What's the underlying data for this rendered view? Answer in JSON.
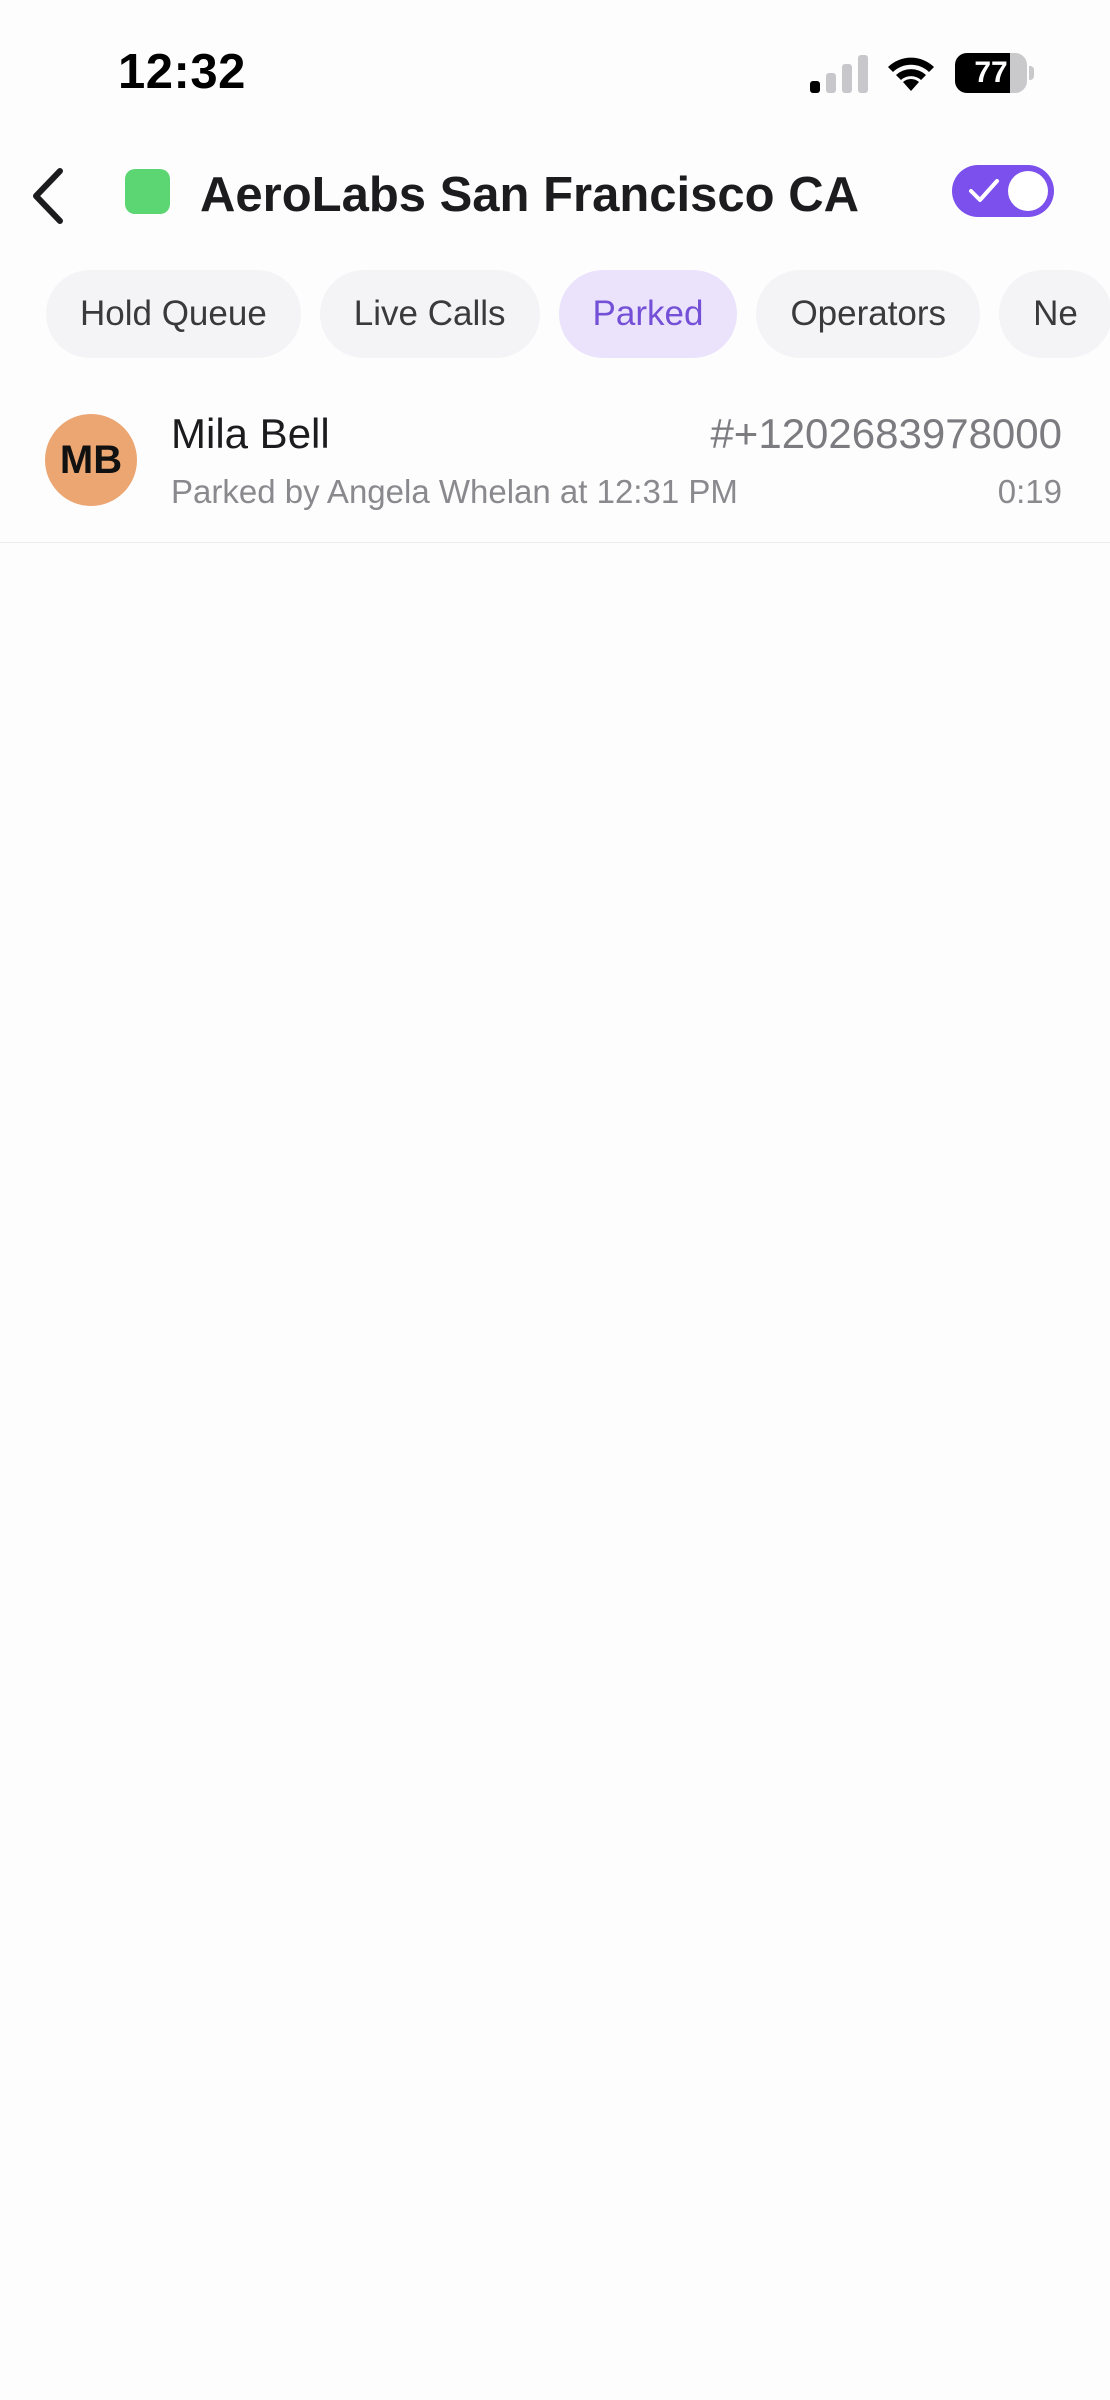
{
  "status_bar": {
    "time": "12:32",
    "battery_level": "77",
    "battery_fraction": 0.77,
    "signal_bars_active": 1,
    "signal_bars_total": 4
  },
  "header": {
    "back_icon": "chevron-left-icon",
    "title": "AeroLabs San Francisco CA",
    "status_color": "#5cd672",
    "toggle_on": true,
    "toggle_color": "#7b50ec"
  },
  "tabs": [
    {
      "label": "Hold Queue",
      "active": false
    },
    {
      "label": "Live Calls",
      "active": false
    },
    {
      "label": "Parked",
      "active": true
    },
    {
      "label": "Operators",
      "active": false
    },
    {
      "label": "Ne",
      "active": false
    }
  ],
  "parked_calls": [
    {
      "initials": "MB",
      "avatar_color": "#eba672",
      "name": "Mila Bell",
      "number": "#+1202683978000",
      "parked_by": "Parked by Angela Whelan at 12:31 PM",
      "duration": "0:19"
    }
  ],
  "colors": {
    "accent": "#7450d6",
    "active_tab_bg": "#ebe3fc",
    "tab_bg": "#f4f4f6"
  }
}
